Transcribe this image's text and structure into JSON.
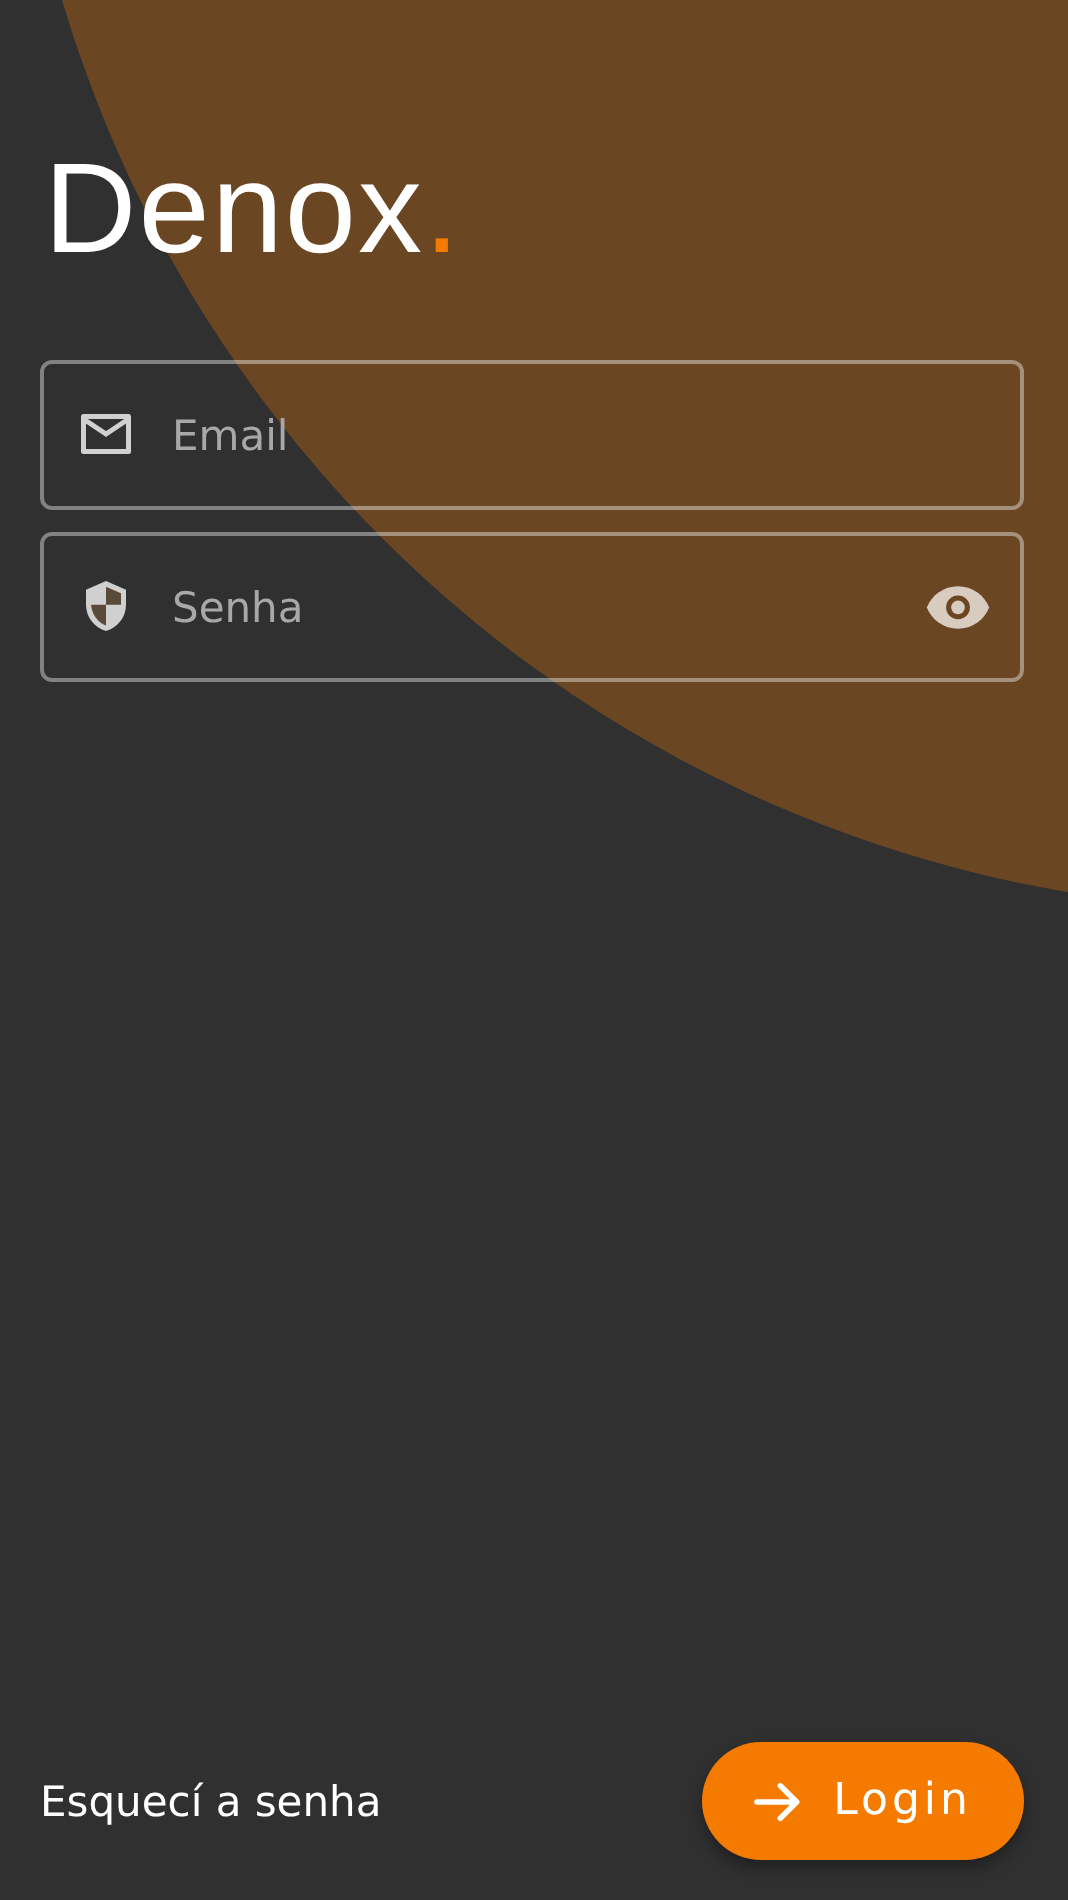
{
  "logo": {
    "name": "Denox",
    "dot": "."
  },
  "fields": [
    {
      "kind": "email",
      "placeholder": "Email"
    },
    {
      "kind": "password",
      "placeholder": "Senha"
    }
  ],
  "forgot_link": "Esquecí a senha",
  "login_button": {
    "label": "Login"
  }
}
